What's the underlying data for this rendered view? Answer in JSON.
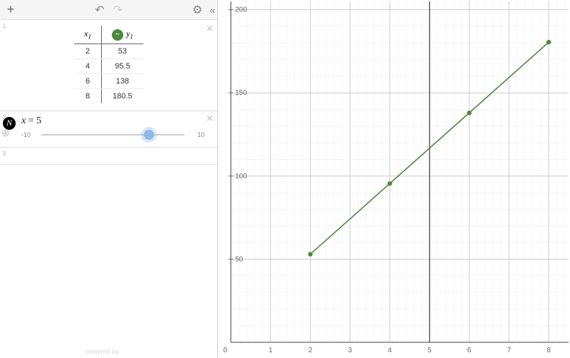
{
  "toolbar": {
    "plus": "+",
    "undo": "↶",
    "redo": "↷",
    "gear": "⚙",
    "collapse": "«"
  },
  "row1": {
    "index": "1",
    "xhead": "x",
    "xsub": "1",
    "yhead": "y",
    "ysub": "1",
    "ybadge": "~",
    "close": "×",
    "rows": [
      {
        "x": "2",
        "y": "53"
      },
      {
        "x": "4",
        "y": "95.5"
      },
      {
        "x": "6",
        "y": "138"
      },
      {
        "x": "8",
        "y": "180.5"
      }
    ]
  },
  "zoom": "⊕",
  "row2": {
    "index": "2",
    "var": "x",
    "eq": " = ",
    "val": "5",
    "min": "-10",
    "max": "10",
    "knob_pct": 75,
    "close": "×",
    "thumb": "N"
  },
  "row3": {
    "index": "3"
  },
  "powered": "powered by",
  "graph": {
    "x_ticks": [
      "1",
      "2",
      "3",
      "4",
      "5",
      "6",
      "7",
      "8"
    ],
    "y_ticks": [
      "50",
      "100",
      "150",
      "200"
    ],
    "origin": "0"
  },
  "chart_data": {
    "type": "scatter",
    "title": "",
    "xlabel": "",
    "ylabel": "",
    "xlim": [
      0,
      8.5
    ],
    "ylim": [
      0,
      205
    ],
    "x_ticks": [
      1,
      2,
      3,
      4,
      5,
      6,
      7,
      8
    ],
    "y_ticks": [
      50,
      100,
      150,
      200
    ],
    "series": [
      {
        "name": "y1",
        "color": "#4a8a3a",
        "x": [
          2,
          4,
          6,
          8
        ],
        "y": [
          53,
          95.5,
          138,
          180.5
        ],
        "connected": true
      }
    ],
    "vline": {
      "x": 5,
      "color": "#666"
    }
  }
}
